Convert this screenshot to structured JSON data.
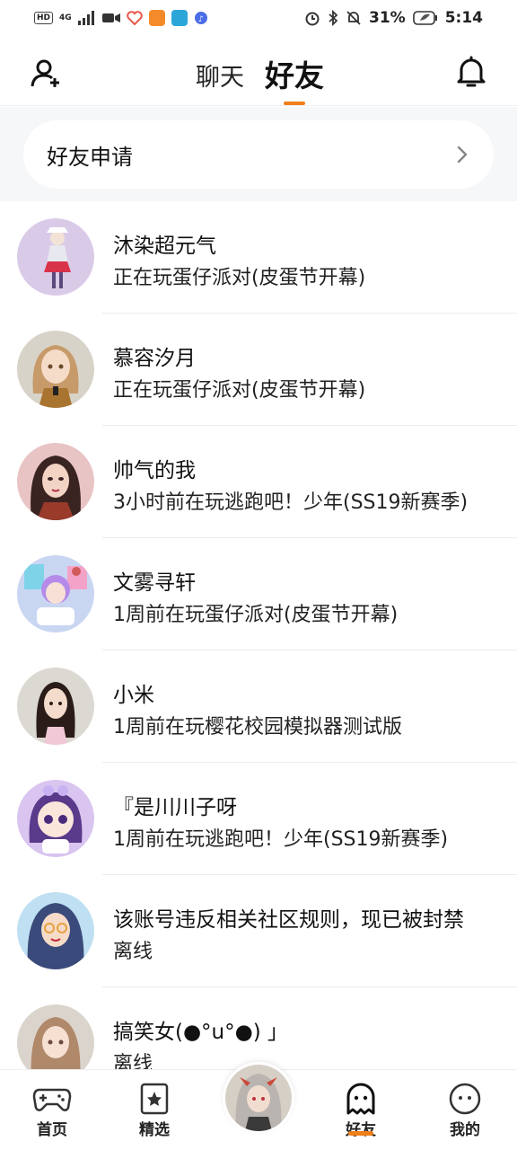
{
  "status_bar": {
    "hd": "HD",
    "network": "4G",
    "battery_percent": "31%",
    "time": "5:14",
    "icons": [
      "hd-icon",
      "signal-icon",
      "video-icon",
      "health-icon",
      "video-app-icon",
      "book-app-icon",
      "music-icon",
      "alarm-icon",
      "bluetooth-icon",
      "mute-icon",
      "battery-icon"
    ]
  },
  "header": {
    "tab_chat": "聊天",
    "tab_friends": "好友",
    "add_friend_icon": "add-user-icon",
    "bell_icon": "bell-icon",
    "accent_color": "#f07f1a"
  },
  "friend_request": {
    "label": "好友申请",
    "chevron_icon": "chevron-right-icon"
  },
  "friends": [
    {
      "name": "沐染超元气",
      "status": "正在玩蛋仔派对(皮蛋节开幕)",
      "avatar_bg": "#d9cbe8"
    },
    {
      "name": "慕容汐月",
      "status": "正在玩蛋仔派对(皮蛋节开幕)",
      "avatar_bg": "#d8d3c8"
    },
    {
      "name": "帅气的我",
      "status": "3小时前在玩逃跑吧！少年(SS19新赛季)",
      "avatar_bg": "#e9c4c4"
    },
    {
      "name": "文雾寻轩",
      "status": "1周前在玩蛋仔派对(皮蛋节开幕)",
      "avatar_bg": "#c9d6f2"
    },
    {
      "name": "小米",
      "status": "1周前在玩樱花校园模拟器测试版",
      "avatar_bg": "#dcd8d2"
    },
    {
      "name": "『是川川子呀",
      "status": "1周前在玩逃跑吧！少年(SS19新赛季)",
      "avatar_bg": "#d9c5f0"
    },
    {
      "name": "该账号违反相关社区规则，现已被封禁",
      "status": "离线",
      "avatar_bg": "#bfe0f2"
    },
    {
      "name": "搞笑女(●°u°●) 」",
      "status": "离线",
      "avatar_bg": "#dbd4cc"
    }
  ],
  "bottom_nav": {
    "home": "首页",
    "featured": "精选",
    "friends": "好友",
    "mine": "我的"
  }
}
